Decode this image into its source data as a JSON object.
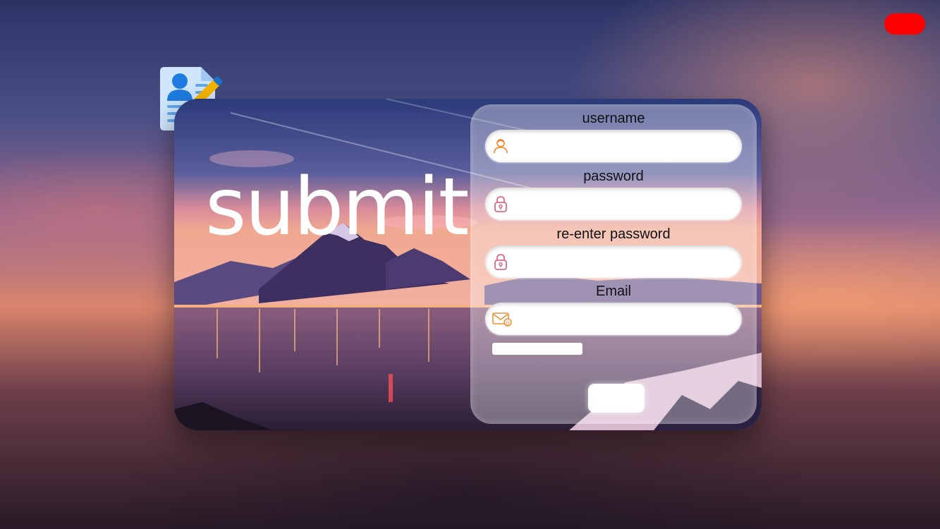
{
  "close_button": {
    "label": "",
    "color": "#ff0000"
  },
  "app_icon": {
    "name": "user-profile-edit-icon"
  },
  "hero": {
    "text": "submit"
  },
  "form": {
    "fields": [
      {
        "label": "username",
        "icon": "user-icon",
        "value": "",
        "placeholder": ""
      },
      {
        "label": "password",
        "icon": "lock-icon",
        "value": "",
        "placeholder": ""
      },
      {
        "label": "re-enter password",
        "icon": "lock-icon",
        "value": "",
        "placeholder": ""
      },
      {
        "label": "Email",
        "icon": "mail-icon",
        "value": "",
        "placeholder": ""
      }
    ],
    "hint": "",
    "submit_label": ""
  },
  "colors": {
    "user_icon": "#f0903a",
    "lock_icon": "#d86a8a",
    "mail_icon": "#e8923a"
  }
}
